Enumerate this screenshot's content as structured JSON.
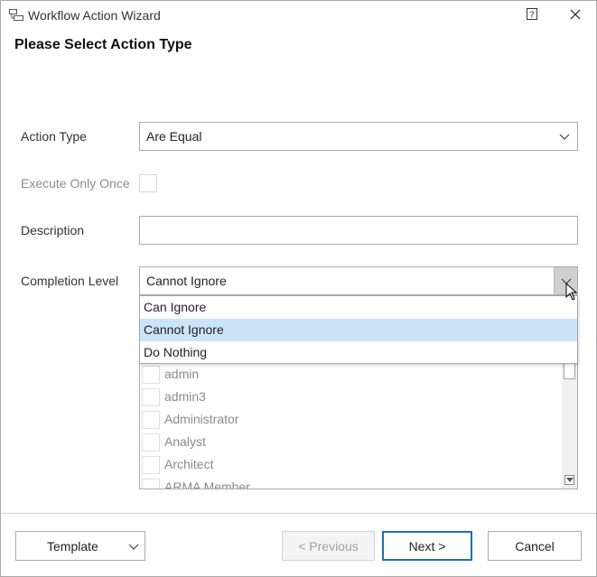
{
  "window": {
    "title": "Workflow Action Wizard",
    "heading": "Please Select Action Type"
  },
  "form": {
    "action_type": {
      "label": "Action Type",
      "value": "Are Equal"
    },
    "execute_once": {
      "label": "Execute Only Once",
      "checked": false
    },
    "description": {
      "label": "Description",
      "value": ""
    },
    "completion_level": {
      "label": "Completion Level",
      "value": "Cannot Ignore",
      "options": [
        "Can Ignore",
        "Cannot Ignore",
        "Do Nothing"
      ],
      "highlighted": "Cannot Ignore"
    }
  },
  "roles_list": {
    "items": [
      "admin",
      "admin3",
      "Administrator",
      "Analyst",
      "Architect",
      "ARMA Member"
    ]
  },
  "footer": {
    "template_label": "Template",
    "previous_label": "< Previous",
    "next_label": "Next >",
    "cancel_label": "Cancel"
  },
  "colors": {
    "highlight": "#cce4f7",
    "primary_border": "#1f6fb4",
    "dropdown_button": "#cfcfcf"
  },
  "icons": [
    "workflow-icon",
    "help-icon",
    "close-icon",
    "chevron-down-icon",
    "mouse-cursor-icon"
  ]
}
